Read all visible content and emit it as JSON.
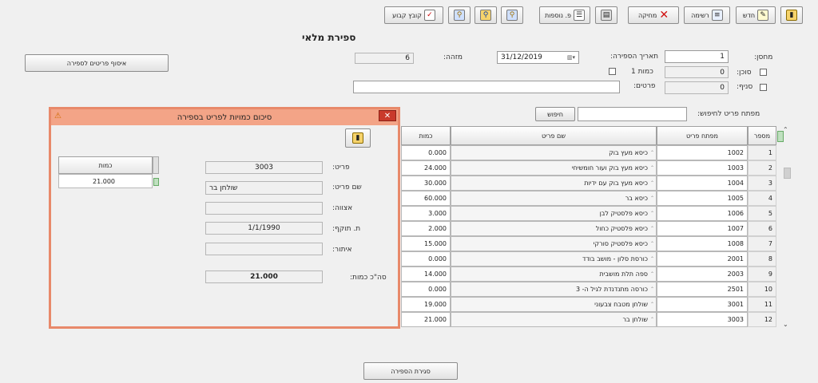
{
  "toolbar": {
    "buttons": [
      {
        "label": "",
        "icon": "exit-door-icon"
      },
      {
        "label": "חדש",
        "icon": "new-doc-icon"
      },
      {
        "label": "רשימה",
        "icon": "list-icon"
      },
      {
        "label": "מחיקה",
        "icon": "delete-x-icon"
      },
      {
        "label": "",
        "icon": "printer-icon"
      },
      {
        "label": "פ. נוספות",
        "icon": "more-actions-icon"
      },
      {
        "label": "",
        "icon": "search-doc-icon"
      },
      {
        "label": "",
        "icon": "folder-search-icon"
      },
      {
        "label": "",
        "icon": "user-search-icon"
      },
      {
        "label": "קובץ קבוע",
        "icon": "fixed-file-icon"
      }
    ]
  },
  "page": {
    "title": "ספירת מלאי"
  },
  "form": {
    "warehouse_label": "מחסן:",
    "warehouse_value": "1",
    "agent_label": "סוכן:",
    "agent_value": "0",
    "branch_label": "סניף:",
    "branch_value": "0",
    "count_date_label": "תאריך הספירה:",
    "count_date_value": "31/12/2019",
    "qty1_label": "כמות 1",
    "details_label": "פרטים:",
    "details_value": "",
    "id_label": "מזהה:",
    "id_value": "6",
    "collect_button": "איסוף פריטים לספירה",
    "search_label": "מפתח פריט לחיפוש:",
    "search_value": "",
    "search_button": "חיפוש",
    "close_count_button": "סגירת הספירה"
  },
  "grid": {
    "columns": {
      "num": "מספר",
      "code": "מפתח פריט",
      "name": "שם פריט",
      "qty": "כמות"
    },
    "rows": [
      {
        "num": "1",
        "code": "1002",
        "name": "כיסא מעץ בוק",
        "qty": "0.000"
      },
      {
        "num": "2",
        "code": "1003",
        "name": "כיסא מעץ בוק ועור חומשיחי",
        "qty": "24.000"
      },
      {
        "num": "3",
        "code": "1004",
        "name": "כיסא מעץ בוק עם ידיות",
        "qty": "30.000"
      },
      {
        "num": "4",
        "code": "1005",
        "name": "כיסא בר",
        "qty": "60.000"
      },
      {
        "num": "5",
        "code": "1006",
        "name": "כיסא פלסטיק לבן",
        "qty": "3.000"
      },
      {
        "num": "6",
        "code": "1007",
        "name": "כיסא פלסטיק כחול",
        "qty": "2.000"
      },
      {
        "num": "7",
        "code": "1008",
        "name": "כיסא פלסטיק סורקי",
        "qty": "15.000"
      },
      {
        "num": "8",
        "code": "2001",
        "name": "כורסת סלון - מושב בודד",
        "qty": "0.000"
      },
      {
        "num": "9",
        "code": "2003",
        "name": "ספה תלת מושבית",
        "qty": "14.000"
      },
      {
        "num": "10",
        "code": "2501",
        "name": "כורסה מתנדנדת לגיל ה- 3",
        "qty": "0.000"
      },
      {
        "num": "11",
        "code": "3001",
        "name": "שולחן מטבח צבעוני",
        "qty": "19.000"
      },
      {
        "num": "12",
        "code": "3003",
        "name": "שולחן בר",
        "qty": "21.000"
      }
    ]
  },
  "modal": {
    "title": "סיכום כמויות לפריט בספירה",
    "item_label": "פריט:",
    "item_value": "3003",
    "item_name_label": "שם פריט:",
    "item_name_value": "שולחן בר",
    "catalog_label": "אצווה:",
    "catalog_value": "",
    "validity_label": "ת. תוקף:",
    "validity_value": "1/1/1990",
    "unit_label": "איתור:",
    "unit_value": "",
    "total_label": "סה\"כ כמות:",
    "total_value": "21.000",
    "qty_header": "כמות",
    "qty_value": "21.000"
  }
}
